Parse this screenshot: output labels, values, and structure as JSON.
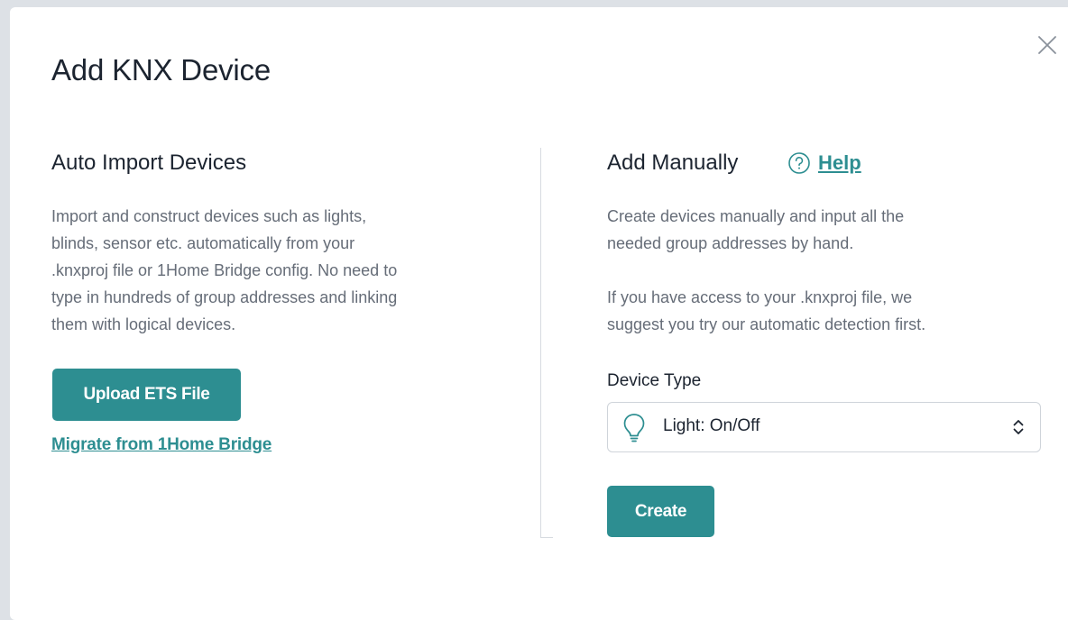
{
  "modal": {
    "title": "Add KNX Device",
    "close_icon": "close-icon"
  },
  "auto_import": {
    "title": "Auto Import Devices",
    "description_lines": [
      "Import and construct devices such as lights,",
      "blinds, sensor etc. automatically from your",
      ".knxproj file or 1Home Bridge config. No need to",
      "type in hundreds of group addresses and linking",
      "them with logical devices."
    ],
    "upload_button": "Upload ETS File",
    "migrate_link": "Migrate from 1Home Bridge"
  },
  "manual": {
    "title": "Add Manually",
    "help_icon": "question-circle-icon",
    "help_label": "Help",
    "description_lines_1": [
      "Create devices manually and input all the",
      "needed group addresses by hand."
    ],
    "description_lines_2": [
      "If you have access to your .knxproj file, we",
      "suggest you try our automatic detection first."
    ],
    "device_type_label": "Device Type",
    "device_type": {
      "icon": "lightbulb-icon",
      "selected": "Light: On/Off",
      "chevron_icon": "chevron-updown-icon"
    },
    "create_button": "Create"
  },
  "colors": {
    "accent": "#2d8e91",
    "backdrop": "#dde1e6",
    "text_primary": "#1c2430",
    "text_secondary": "#666d78",
    "divider": "#d7dbe0"
  }
}
